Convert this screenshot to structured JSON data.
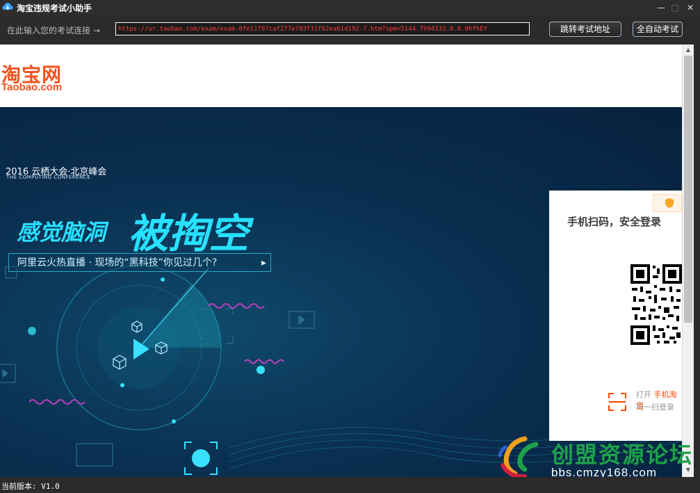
{
  "window": {
    "title": "淘宝违规考试小助手",
    "minimize_glyph": "—",
    "maximize_glyph": "□",
    "close_glyph": "✕"
  },
  "toolbar": {
    "url_label": "在此输入您的考试连接 →",
    "url_value": "https://ur.taobao.com/exam/exam-0fe11f97caf277e703f31f62ea61d192-7.htm?spm=5144.7994333.0.0.0hfhEY",
    "jump_button": "跳转考试地址",
    "auto_button": "全自动考试"
  },
  "page": {
    "logo_cn": "淘宝网",
    "logo_en": "Taobao.com",
    "banner": {
      "conference_line1": "2016 云栖大会·北京峰会",
      "conference_line2": "THE COMPUTING CONFERENCE",
      "slogan_small": "感觉脑洞",
      "slogan_big": "被掏空",
      "subline": "阿里云火热直播 · 现场的“黑科技”你见过几个?"
    },
    "login": {
      "title": "手机扫码，安全登录",
      "open_prefix": "打开",
      "open_app": "手机淘宝",
      "scan_text": "扫一扫登录"
    }
  },
  "watermark": {
    "text": "创盟资源论坛",
    "url": "bbs.cmzy168.com"
  },
  "status": {
    "version": "当前版本: V1.0"
  },
  "colors": {
    "taobao_orange": "#f1531e",
    "url_text_red": "#ff3b3b",
    "banner_cyan": "#28e0ff",
    "watermark_green": "#1ea14a"
  }
}
